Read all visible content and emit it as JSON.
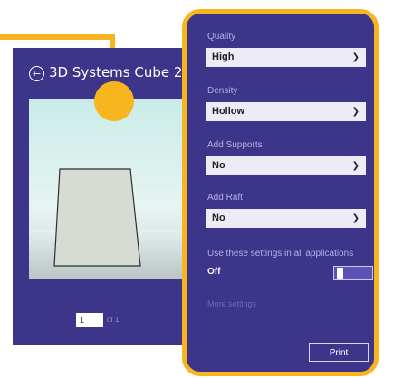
{
  "window": {
    "printer_name": "3D Systems Cube 2"
  },
  "preview": {
    "page_number": "1",
    "page_of": "of 1"
  },
  "settings": {
    "quality": {
      "label": "Quality",
      "value": "High"
    },
    "density": {
      "label": "Density",
      "value": "Hollow"
    },
    "supports": {
      "label": "Add Supports",
      "value": "No"
    },
    "raft": {
      "label": "Add Raft",
      "value": "No"
    },
    "apply_all": {
      "label": "Use these settings in all applications",
      "state": "Off"
    },
    "more_link": "More settings",
    "print_label": "Print"
  },
  "colors": {
    "panel_bg": "#3c358a",
    "accent": "#f7b61d",
    "select_bg": "#ecebf6"
  }
}
